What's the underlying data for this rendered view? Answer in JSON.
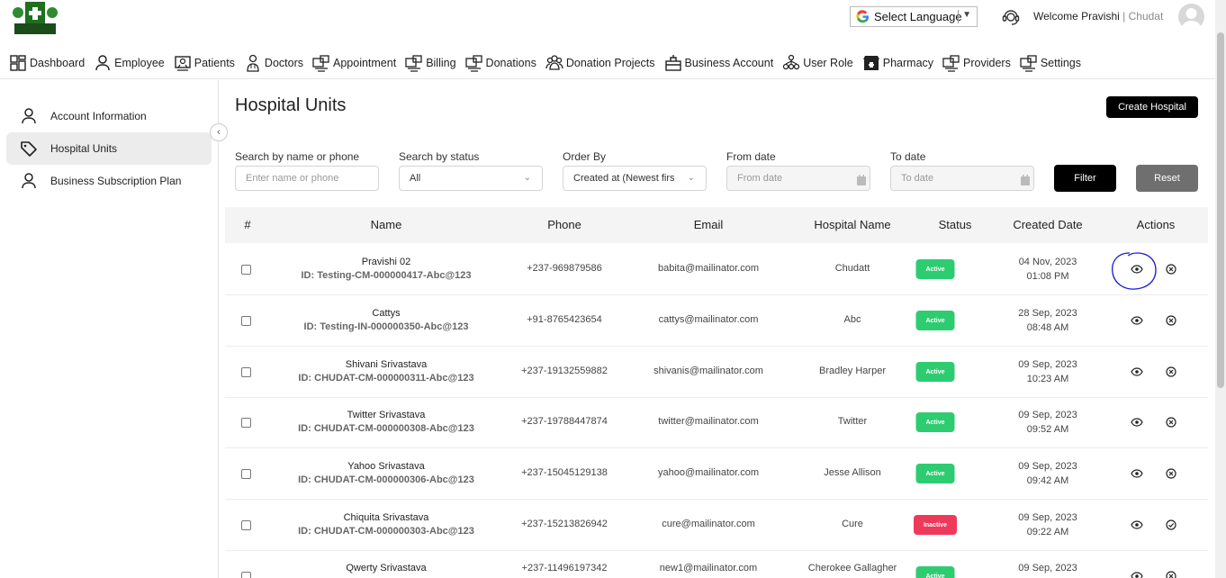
{
  "header": {
    "language_label": "Select Language",
    "welcome_prefix": "Welcome Pravishi",
    "welcome_org": "Chudat"
  },
  "nav": [
    {
      "label": "Dashboard",
      "icon": "dashboard-icon"
    },
    {
      "label": "Employee",
      "icon": "user-icon"
    },
    {
      "label": "Patients",
      "icon": "patients-icon"
    },
    {
      "label": "Doctors",
      "icon": "doctor-icon"
    },
    {
      "label": "Appointment",
      "icon": "appointment-icon"
    },
    {
      "label": "Billing",
      "icon": "billing-icon"
    },
    {
      "label": "Donations",
      "icon": "donations-icon"
    },
    {
      "label": "Donation Projects",
      "icon": "group-icon"
    },
    {
      "label": "Business Account",
      "icon": "business-icon"
    },
    {
      "label": "User Role",
      "icon": "user-role-icon"
    },
    {
      "label": "Pharmacy",
      "icon": "pharmacy-icon"
    },
    {
      "label": "Providers",
      "icon": "providers-icon"
    },
    {
      "label": "Settings",
      "icon": "settings-icon"
    }
  ],
  "sidebar": [
    {
      "label": "Account Information",
      "icon": "user-icon",
      "active": false
    },
    {
      "label": "Hospital Units",
      "icon": "tag-icon",
      "active": true
    },
    {
      "label": "Business Subscription Plan",
      "icon": "user-icon",
      "active": false
    }
  ],
  "page": {
    "title": "Hospital Units",
    "create_label": "Create Hospital"
  },
  "filters": {
    "search_label": "Search by name or phone",
    "search_placeholder": "Enter name or phone",
    "status_label": "Search by status",
    "status_value": "All",
    "order_label": "Order By",
    "order_value": "Created at (Newest firs",
    "from_label": "From date",
    "from_placeholder": "From date",
    "to_label": "To date",
    "to_placeholder": "To date",
    "filter_label": "Filter",
    "reset_label": "Reset"
  },
  "table": {
    "headers": [
      "#",
      "Name",
      "Phone",
      "Email",
      "Hospital Name",
      "Status",
      "Created Date",
      "Actions"
    ],
    "rows": [
      {
        "name": "Pravishi 02",
        "id": "ID: Testing-CM-000000417-Abc@123",
        "phone": "+237-969879586",
        "email": "babita@mailinator.com",
        "hospital": "Chudatt",
        "status": "Active",
        "date": "04 Nov, 2023",
        "time": "01:08 PM",
        "toggle": "deactivate"
      },
      {
        "name": "Cattys",
        "id": "ID: Testing-IN-000000350-Abc@123",
        "phone": "+91-8765423654",
        "email": "cattys@mailinator.com",
        "hospital": "Abc",
        "status": "Active",
        "date": "28 Sep, 2023",
        "time": "08:48 AM",
        "toggle": "deactivate"
      },
      {
        "name": "Shivani Srivastava",
        "id": "ID: CHUDAT-CM-000000311-Abc@123",
        "phone": "+237-19132559882",
        "email": "shivanis@mailinator.com",
        "hospital": "Bradley Harper",
        "status": "Active",
        "date": "09 Sep, 2023",
        "time": "10:23 AM",
        "toggle": "deactivate"
      },
      {
        "name": "Twitter Srivastava",
        "id": "ID: CHUDAT-CM-000000308-Abc@123",
        "phone": "+237-19788447874",
        "email": "twitter@mailinator.com",
        "hospital": "Twitter",
        "status": "Active",
        "date": "09 Sep, 2023",
        "time": "09:52 AM",
        "toggle": "deactivate"
      },
      {
        "name": "Yahoo Srivastava",
        "id": "ID: CHUDAT-CM-000000306-Abc@123",
        "phone": "+237-15045129138",
        "email": "yahoo@mailinator.com",
        "hospital": "Jesse Allison",
        "status": "Active",
        "date": "09 Sep, 2023",
        "time": "09:42 AM",
        "toggle": "deactivate"
      },
      {
        "name": "Chiquita Srivastava",
        "id": "ID: CHUDAT-CM-000000303-Abc@123",
        "phone": "+237-15213826942",
        "email": "cure@mailinator.com",
        "hospital": "Cure",
        "status": "Inactive",
        "date": "09 Sep, 2023",
        "time": "09:22 AM",
        "toggle": "activate"
      },
      {
        "name": "Qwerty Srivastava",
        "id": "",
        "phone": "+237-11496197342",
        "email": "new1@mailinator.com",
        "hospital": "Cherokee Gallagher",
        "status": "Active",
        "date": "09 Sep, 2023",
        "time": "",
        "toggle": "deactivate"
      }
    ]
  },
  "colors": {
    "active": "#2ecc71",
    "inactive": "#f0385a",
    "annotation": "#1a1adb"
  }
}
